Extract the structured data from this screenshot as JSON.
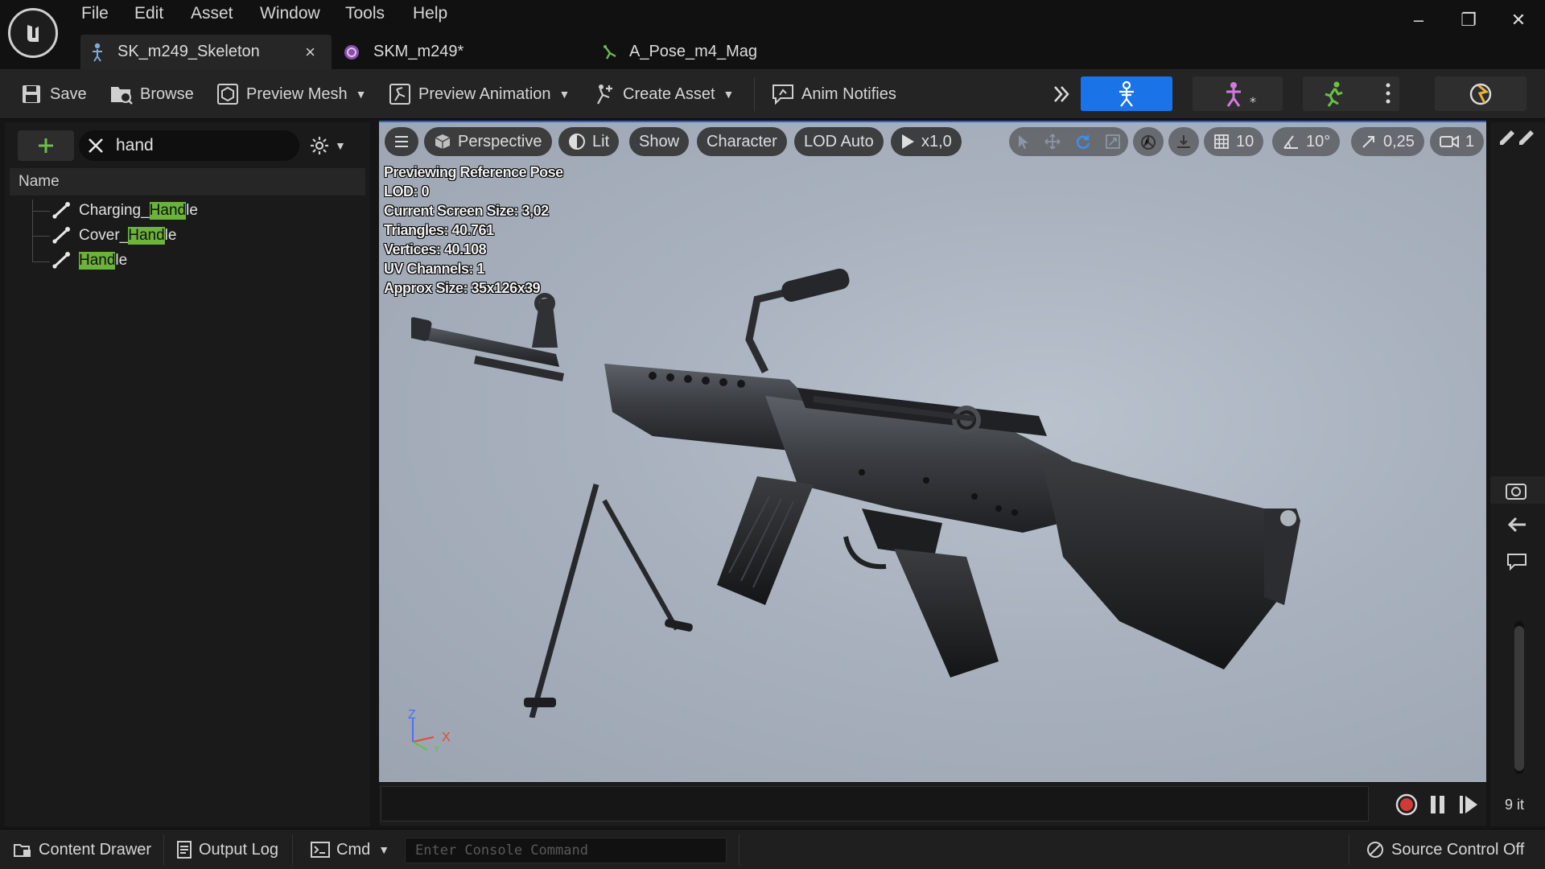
{
  "menu": {
    "items": [
      "File",
      "Edit",
      "Asset",
      "Window",
      "Tools",
      "Help"
    ]
  },
  "tabs": [
    {
      "label": "SK_m249_Skeleton",
      "icon": "skeleton-icon",
      "active": true,
      "close": "×"
    },
    {
      "label": "SKM_m249*",
      "icon": "skeletal-mesh-icon",
      "active": false
    },
    {
      "label": "A_Pose_m4_Mag",
      "icon": "animation-icon",
      "active": false
    }
  ],
  "window_controls": {
    "minimize": "–",
    "restore": "❐",
    "close": "✕"
  },
  "toolbar": {
    "save": "Save",
    "browse": "Browse",
    "preview_mesh": "Preview Mesh",
    "preview_animation": "Preview Animation",
    "create_asset": "Create Asset",
    "anim_notifies": "Anim Notifies",
    "accent_color": "#1a74e8"
  },
  "skeleton_tree": {
    "search_value": "hand",
    "column_header": "Name",
    "bones": [
      {
        "prefix": "Charging_",
        "match": "Hand",
        "suffix": "le"
      },
      {
        "prefix": "Cover_",
        "match": "Hand",
        "suffix": "le"
      },
      {
        "prefix": "",
        "match": "Hand",
        "suffix": "le"
      }
    ],
    "highlight_color": "#6bb33a"
  },
  "viewport": {
    "view_mode": "Perspective",
    "lighting": "Lit",
    "show": "Show",
    "character": "Character",
    "lod": "LOD Auto",
    "play_rate": "x1,0",
    "grid_snap": "10",
    "rotation_snap": "10°",
    "scale_snap": "0,25",
    "camera_speed": "1",
    "stats": [
      "Previewing Reference Pose",
      "LOD: 0",
      "Current Screen Size: 3,02",
      "Triangles: 40.761",
      "Vertices: 40.108",
      "UV Channels: 1",
      "Approx Size: 35x126x39"
    ],
    "axis": {
      "z": "Z",
      "x": "X",
      "y": "Y"
    }
  },
  "timeline": {
    "frame_label": "9 it"
  },
  "statusbar": {
    "content_drawer": "Content Drawer",
    "output_log": "Output Log",
    "cmd": "Cmd",
    "console_placeholder": "Enter Console Command",
    "source_control": "Source Control Off"
  }
}
